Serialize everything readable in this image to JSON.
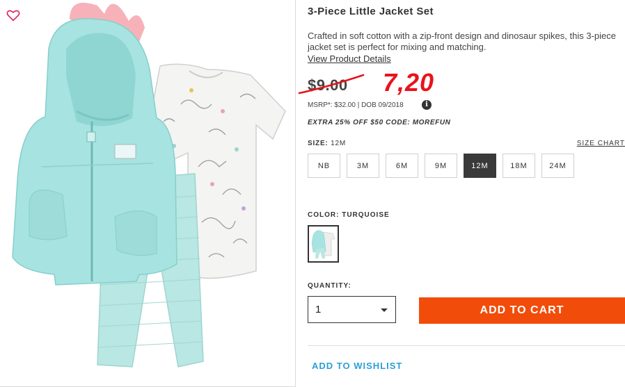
{
  "product": {
    "title": "3-Piece Little Jacket Set",
    "description": "Crafted in soft cotton with a zip-front design and dinosaur spikes, this 3-piece jacket set is perfect for mixing and matching.",
    "view_details": "View Product Details",
    "old_price": "$9.00",
    "new_price": "7,20",
    "msrp": "MSRP*: $32.00 | DOB 09/2018",
    "info_icon": "i",
    "promo": "EXTRA 25% OFF $50 CODE: MOREFUN"
  },
  "size": {
    "label": "SIZE:",
    "selected": "12M",
    "chart_link": "SIZE CHART",
    "options": [
      "NB",
      "3M",
      "6M",
      "9M",
      "12M",
      "18M",
      "24M"
    ]
  },
  "color": {
    "label": "COLOR: TURQUOISE"
  },
  "quantity": {
    "label": "QUANTITY:",
    "value": "1"
  },
  "actions": {
    "add_to_cart": "ADD TO CART",
    "add_to_wishlist": "ADD TO WISHLIST"
  },
  "colors": {
    "accent_orange": "#f24c0b",
    "new_price_red": "#e8131b",
    "wishlist_blue": "#2a9fd6",
    "heart_pink": "#e0245e",
    "jacket_turquoise": "#a7e3e0"
  },
  "icons": {
    "heart": "heart-outline-icon",
    "info": "info-circle-icon",
    "caret": "chevron-down-icon"
  }
}
